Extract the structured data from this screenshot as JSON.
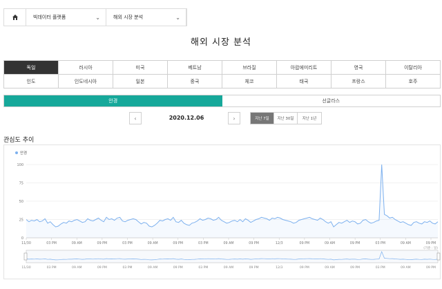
{
  "breadcrumb": {
    "home_icon": "home-icon",
    "items": [
      "빅데이터 플랫폼",
      "해외 시장 분석"
    ]
  },
  "page_title": "해외 시장 분석",
  "countries": [
    "독일",
    "러시아",
    "미국",
    "베트남",
    "브라질",
    "아랍에미리트",
    "영국",
    "이탈리아",
    "인도",
    "인도네시아",
    "일본",
    "중국",
    "체코",
    "태국",
    "프랑스",
    "호주"
  ],
  "active_country": "독일",
  "region_tabs": [
    "안경",
    "선글라스"
  ],
  "active_region": "안경",
  "date_nav": {
    "date": "2020.12.06",
    "prev": "‹",
    "next": "›"
  },
  "periods": [
    "지난 7일",
    "지난 30일",
    "지난 1년"
  ],
  "active_period": "지난 7일",
  "section_title": "관심도 추이",
  "colors": {
    "accent": "#16a89a",
    "line": "#7cb0ee",
    "active_cell": "#333333"
  },
  "chart_data": {
    "type": "line",
    "title": "",
    "legend": "top-left",
    "series": [
      {
        "name": "안경",
        "values": [
          25,
          22,
          24,
          23,
          25,
          22,
          23,
          26,
          20,
          22,
          18,
          15,
          16,
          19,
          21,
          20,
          23,
          22,
          24,
          25,
          23,
          21,
          22,
          26,
          24,
          23,
          25,
          27,
          24,
          22,
          28,
          25,
          26,
          24,
          27,
          28,
          23,
          22,
          24,
          25,
          26,
          25,
          22,
          19,
          21,
          20,
          16,
          15,
          17,
          20,
          24,
          23,
          25,
          26,
          24,
          28,
          22,
          21,
          24,
          20,
          18,
          17,
          20,
          21,
          23,
          26,
          24,
          25,
          27,
          26,
          24,
          25,
          28,
          24,
          22,
          20,
          21,
          23,
          24,
          22,
          25,
          22,
          26,
          24,
          21,
          23,
          25,
          26,
          28,
          27,
          26,
          24,
          27,
          26,
          28,
          27,
          25,
          24,
          23,
          22,
          20,
          21,
          24,
          25,
          26,
          27,
          28,
          26,
          25,
          24,
          27,
          25,
          22,
          20,
          22,
          15,
          18,
          21,
          20,
          22,
          24,
          21,
          23,
          22,
          19,
          20,
          24,
          25,
          22,
          20,
          21,
          23,
          24,
          100,
          32,
          30,
          27,
          28,
          25,
          23,
          21,
          22,
          20,
          18,
          17,
          21,
          22,
          20,
          19,
          22,
          21,
          23,
          20,
          19,
          22
        ]
      }
    ],
    "ylim": [
      0,
      100
    ],
    "y_ticks": [
      "100",
      "75",
      "50",
      "25",
      "0"
    ],
    "x_ticks": [
      "11/30",
      "03 PM",
      "09 AM",
      "09 PM",
      "03 PM",
      "09 AM",
      "09 PM",
      "03 PM",
      "09 AM",
      "09 PM",
      "12/3",
      "09 PM",
      "09 AM",
      "09 PM",
      "03 PM",
      "09 AM",
      "09 PM"
    ],
    "grid": true,
    "timezone_note": "(기준 : 일)"
  }
}
